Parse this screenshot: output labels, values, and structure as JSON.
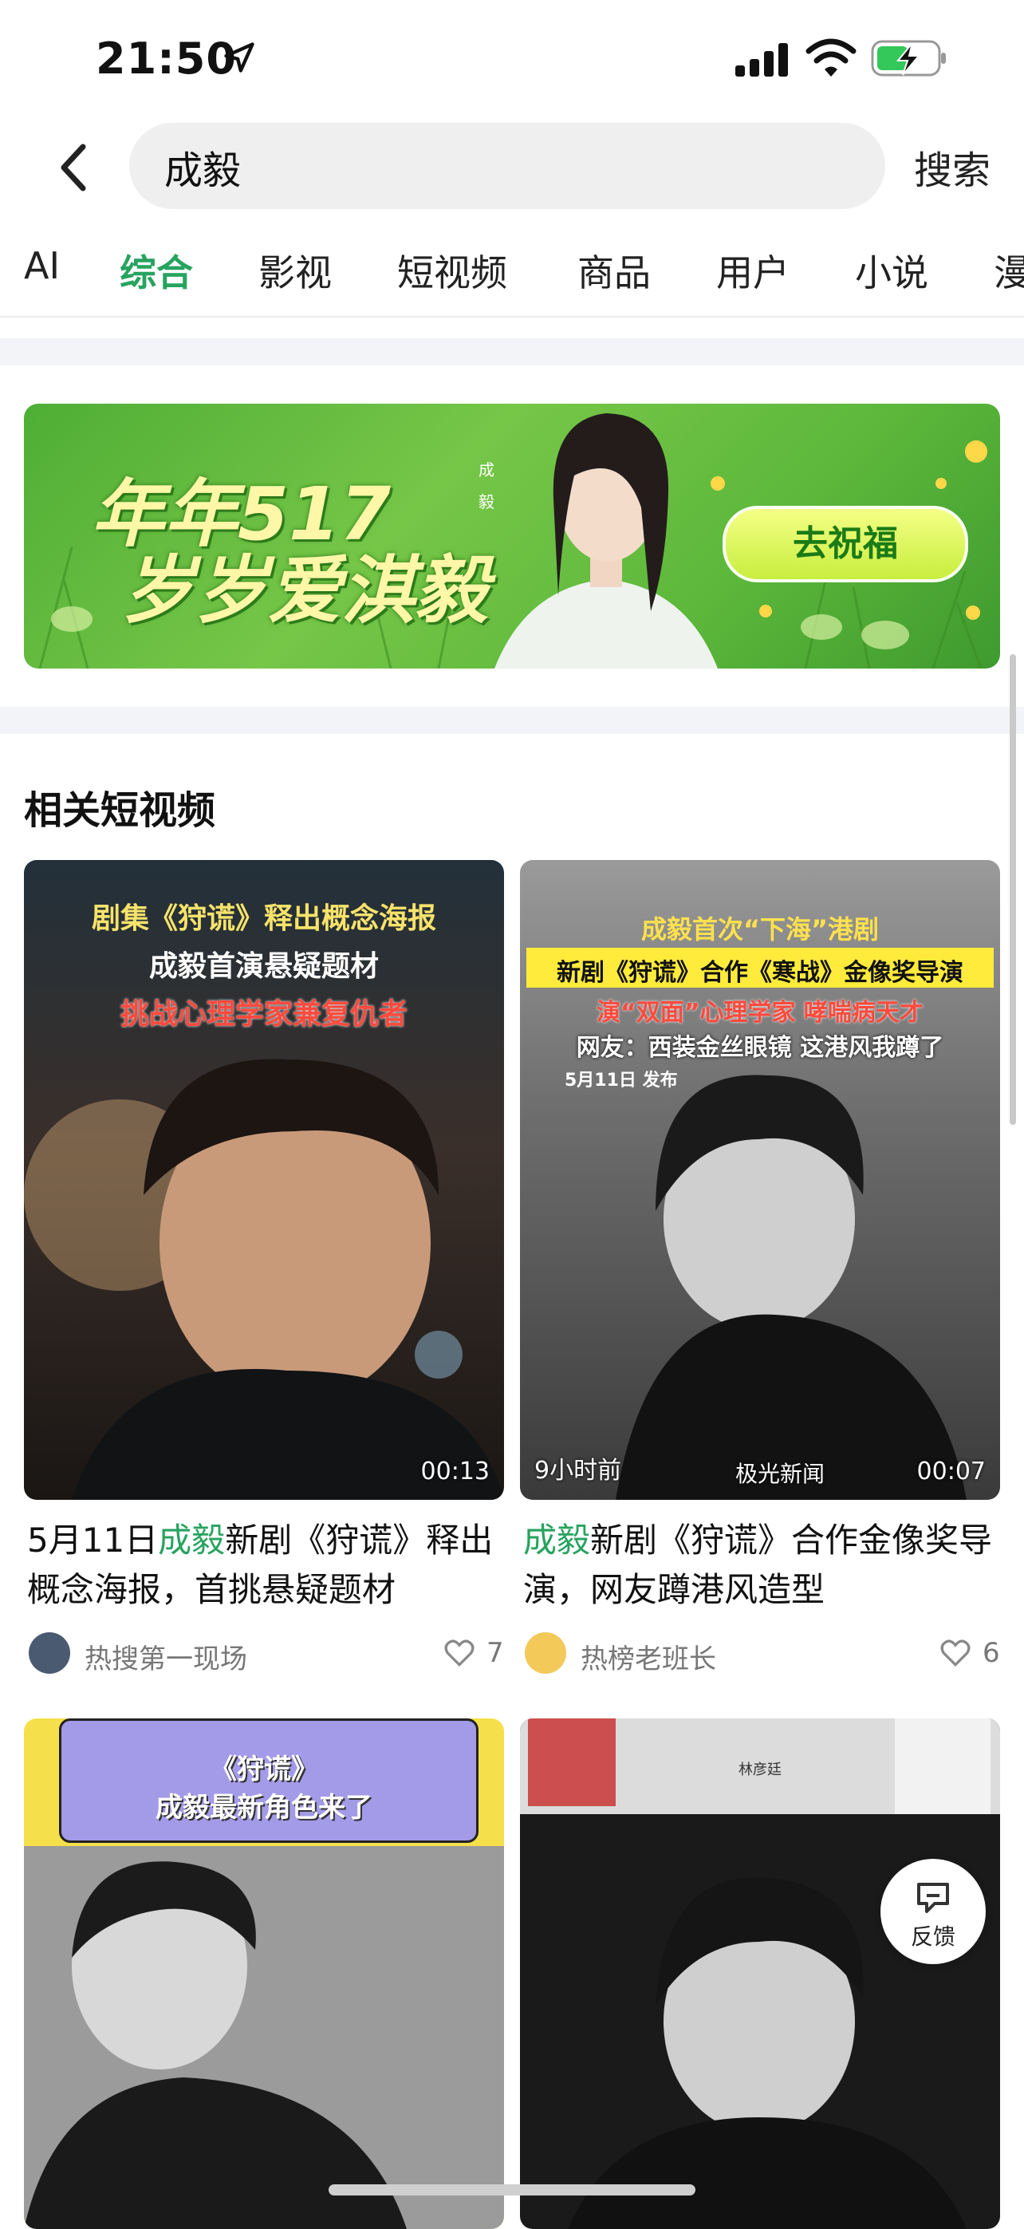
{
  "status_bar": {
    "time": "21:50",
    "icons": [
      "location-arrow-icon",
      "signal-icon",
      "wifi-icon",
      "battery-charging-icon"
    ]
  },
  "search": {
    "query": "成毅",
    "button_label": "搜索"
  },
  "tabs": [
    "AI",
    "综合",
    "影视",
    "短视频",
    "商品",
    "用户",
    "小说",
    "漫"
  ],
  "active_tab": "综合",
  "banner": {
    "line1": "年年517",
    "line2": "岁岁爱淇毅",
    "cta": "去祝福"
  },
  "section": {
    "title": "相关短视频"
  },
  "cards": [
    {
      "caption": [
        "剧集《狩谎》释出概念海报",
        "成毅首演悬疑题材",
        "挑战心理学家兼复仇者"
      ],
      "badge": "",
      "duration": "00:13",
      "title_pre": "5月11日",
      "title_hl": "成毅",
      "title_post": "新剧《狩谎》释出概念海报，首挑悬疑题材",
      "author": "热搜第一现场",
      "likes": "7"
    },
    {
      "caption": [
        "成毅首次“下海”港剧",
        "新剧《狩谎》合作《寒战》金像奖导演",
        "演“双面”心理学家 哮喘病天才",
        "网友：西装金丝眼镜 这港风我蹲了",
        "5月11日 发布"
      ],
      "badge": "9小时前",
      "duration": "00:07",
      "watermark": "极光新闻",
      "title_pre": "",
      "title_hl": "成毅",
      "title_post": "新剧《狩谎》合作金像奖导演，网友蹲港风造型",
      "author": "热榜老班长",
      "likes": "6"
    },
    {
      "caption": [
        "《狩谎》",
        "成毅最新角色来了"
      ]
    },
    {
      "caption": [
        "林彦廷"
      ]
    }
  ],
  "feedback": {
    "label": "反馈"
  },
  "colors": {
    "accent": "#27a360",
    "banner_green": "#5db83b"
  }
}
